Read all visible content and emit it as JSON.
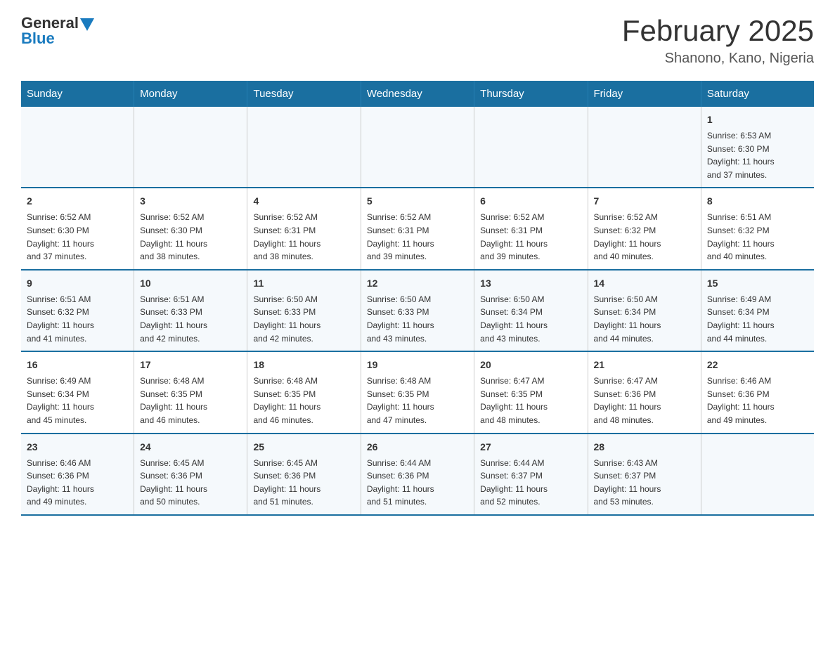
{
  "header": {
    "logo_general": "General",
    "logo_blue": "Blue",
    "title": "February 2025",
    "subtitle": "Shanono, Kano, Nigeria"
  },
  "weekdays": [
    "Sunday",
    "Monday",
    "Tuesday",
    "Wednesday",
    "Thursday",
    "Friday",
    "Saturday"
  ],
  "weeks": [
    [
      {
        "day": "",
        "info": ""
      },
      {
        "day": "",
        "info": ""
      },
      {
        "day": "",
        "info": ""
      },
      {
        "day": "",
        "info": ""
      },
      {
        "day": "",
        "info": ""
      },
      {
        "day": "",
        "info": ""
      },
      {
        "day": "1",
        "info": "Sunrise: 6:53 AM\nSunset: 6:30 PM\nDaylight: 11 hours\nand 37 minutes."
      }
    ],
    [
      {
        "day": "2",
        "info": "Sunrise: 6:52 AM\nSunset: 6:30 PM\nDaylight: 11 hours\nand 37 minutes."
      },
      {
        "day": "3",
        "info": "Sunrise: 6:52 AM\nSunset: 6:30 PM\nDaylight: 11 hours\nand 38 minutes."
      },
      {
        "day": "4",
        "info": "Sunrise: 6:52 AM\nSunset: 6:31 PM\nDaylight: 11 hours\nand 38 minutes."
      },
      {
        "day": "5",
        "info": "Sunrise: 6:52 AM\nSunset: 6:31 PM\nDaylight: 11 hours\nand 39 minutes."
      },
      {
        "day": "6",
        "info": "Sunrise: 6:52 AM\nSunset: 6:31 PM\nDaylight: 11 hours\nand 39 minutes."
      },
      {
        "day": "7",
        "info": "Sunrise: 6:52 AM\nSunset: 6:32 PM\nDaylight: 11 hours\nand 40 minutes."
      },
      {
        "day": "8",
        "info": "Sunrise: 6:51 AM\nSunset: 6:32 PM\nDaylight: 11 hours\nand 40 minutes."
      }
    ],
    [
      {
        "day": "9",
        "info": "Sunrise: 6:51 AM\nSunset: 6:32 PM\nDaylight: 11 hours\nand 41 minutes."
      },
      {
        "day": "10",
        "info": "Sunrise: 6:51 AM\nSunset: 6:33 PM\nDaylight: 11 hours\nand 42 minutes."
      },
      {
        "day": "11",
        "info": "Sunrise: 6:50 AM\nSunset: 6:33 PM\nDaylight: 11 hours\nand 42 minutes."
      },
      {
        "day": "12",
        "info": "Sunrise: 6:50 AM\nSunset: 6:33 PM\nDaylight: 11 hours\nand 43 minutes."
      },
      {
        "day": "13",
        "info": "Sunrise: 6:50 AM\nSunset: 6:34 PM\nDaylight: 11 hours\nand 43 minutes."
      },
      {
        "day": "14",
        "info": "Sunrise: 6:50 AM\nSunset: 6:34 PM\nDaylight: 11 hours\nand 44 minutes."
      },
      {
        "day": "15",
        "info": "Sunrise: 6:49 AM\nSunset: 6:34 PM\nDaylight: 11 hours\nand 44 minutes."
      }
    ],
    [
      {
        "day": "16",
        "info": "Sunrise: 6:49 AM\nSunset: 6:34 PM\nDaylight: 11 hours\nand 45 minutes."
      },
      {
        "day": "17",
        "info": "Sunrise: 6:48 AM\nSunset: 6:35 PM\nDaylight: 11 hours\nand 46 minutes."
      },
      {
        "day": "18",
        "info": "Sunrise: 6:48 AM\nSunset: 6:35 PM\nDaylight: 11 hours\nand 46 minutes."
      },
      {
        "day": "19",
        "info": "Sunrise: 6:48 AM\nSunset: 6:35 PM\nDaylight: 11 hours\nand 47 minutes."
      },
      {
        "day": "20",
        "info": "Sunrise: 6:47 AM\nSunset: 6:35 PM\nDaylight: 11 hours\nand 48 minutes."
      },
      {
        "day": "21",
        "info": "Sunrise: 6:47 AM\nSunset: 6:36 PM\nDaylight: 11 hours\nand 48 minutes."
      },
      {
        "day": "22",
        "info": "Sunrise: 6:46 AM\nSunset: 6:36 PM\nDaylight: 11 hours\nand 49 minutes."
      }
    ],
    [
      {
        "day": "23",
        "info": "Sunrise: 6:46 AM\nSunset: 6:36 PM\nDaylight: 11 hours\nand 49 minutes."
      },
      {
        "day": "24",
        "info": "Sunrise: 6:45 AM\nSunset: 6:36 PM\nDaylight: 11 hours\nand 50 minutes."
      },
      {
        "day": "25",
        "info": "Sunrise: 6:45 AM\nSunset: 6:36 PM\nDaylight: 11 hours\nand 51 minutes."
      },
      {
        "day": "26",
        "info": "Sunrise: 6:44 AM\nSunset: 6:36 PM\nDaylight: 11 hours\nand 51 minutes."
      },
      {
        "day": "27",
        "info": "Sunrise: 6:44 AM\nSunset: 6:37 PM\nDaylight: 11 hours\nand 52 minutes."
      },
      {
        "day": "28",
        "info": "Sunrise: 6:43 AM\nSunset: 6:37 PM\nDaylight: 11 hours\nand 53 minutes."
      },
      {
        "day": "",
        "info": ""
      }
    ]
  ]
}
